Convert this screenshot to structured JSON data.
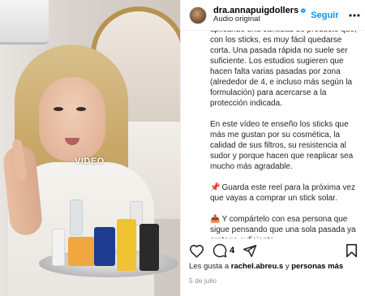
{
  "post": {
    "username": "dra.annapuigdollers",
    "audio_label": "Audio original",
    "follow_label": "Seguir",
    "video_watermark": "VIDEO",
    "caption_paragraphs": [
      "aplicando una cantidad de producto que, con los sticks, es muy fácil quedarse corta. Una pasada rápida no suele ser suficiente. Los estudios sugieren que hacen falta varias pasadas por zona (alrededor de 4, e incluso más según la formulación) para acercarse a la protección indicada.",
      "En este vídeo te enseño los sticks que más me gustan por su cosmética, la calidad de sus filtros, su resistencia al sudor y porque hacen que reaplicar sea mucho más agradable.",
      "Guarda este reel para la próxima vez que vayas a comprar un stick solar.",
      "Y compártelo con esa persona que sigue pensando que una sola pasada ya protege suficiente."
    ],
    "caption_emojis": [
      "📌",
      "📤"
    ],
    "comment_count": "4",
    "likes_prefix": "Les gusta a ",
    "likes_user": "rachel.abreu.s",
    "likes_joiner": " y ",
    "likes_rest": "personas más",
    "date": "5 de julio"
  },
  "icons": {
    "verified": "verified-badge-icon",
    "more": "more-options-icon",
    "heart": "heart-icon",
    "comment": "comment-icon",
    "share": "share-icon",
    "bookmark": "bookmark-icon"
  },
  "colors": {
    "follow_blue": "#0095f6",
    "verified_blue": "#0095f6",
    "date_gray": "#8e8e8e"
  }
}
